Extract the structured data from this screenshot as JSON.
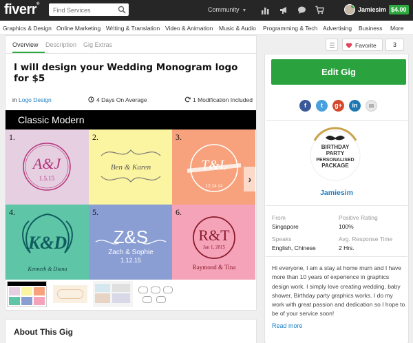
{
  "topbar": {
    "logo": "fiverr",
    "logo_mark": "®",
    "search_placeholder": "Find Services",
    "community": "Community",
    "username": "Jamiesim",
    "balance": "$4.00",
    "icons": [
      "bar-chart-icon",
      "megaphone-icon",
      "chat-icon",
      "cart-icon"
    ]
  },
  "categories": [
    "Graphics & Design",
    "Online Marketing",
    "Writing & Translation",
    "Video & Animation",
    "Music & Audio",
    "Programming & Tech",
    "Advertising",
    "Business",
    "More"
  ],
  "tabs": [
    "Overview",
    "Description",
    "Gig Extras"
  ],
  "gig": {
    "title": "I will design your Wedding Monogram logo for $5",
    "category_prefix": "in",
    "category": "Logo Design",
    "delivery": "4 Days On Average",
    "modifications": "1 Modification Included",
    "banner": "Classic Modern",
    "samples": [
      {
        "num": "1.",
        "initials": "A&J",
        "line": "1.5.15",
        "bg": "#e5cfe1"
      },
      {
        "num": "2.",
        "initials": "Ben & Karen",
        "line": "",
        "bg": "#fbf4a0"
      },
      {
        "num": "3.",
        "initials": "T&L",
        "line": "12.24.14",
        "bg": "#f7a27c"
      },
      {
        "num": "4.",
        "initials": "K&D",
        "line": "Kenneth & Diana",
        "bg": "#5ec6a6"
      },
      {
        "num": "5.",
        "initials": "Z&S",
        "line": "Zach & Sophie",
        "line2": "1.12.15",
        "bg": "#8a9ed3"
      },
      {
        "num": "6.",
        "initials": "R&T",
        "line": "Jan 1, 2015",
        "line2": "Raymond & Tina",
        "bg": "#f5a3b8"
      }
    ]
  },
  "about": {
    "heading": "About This Gig"
  },
  "actions": {
    "favorite_label": "Favorite",
    "favorite_count": "3",
    "edit_label": "Edit Gig"
  },
  "social": [
    {
      "name": "facebook",
      "glyph": "f",
      "color": "#3b5998"
    },
    {
      "name": "twitter",
      "glyph": "t",
      "color": "#4aa0dc"
    },
    {
      "name": "google-plus",
      "glyph": "g+",
      "color": "#d6492f"
    },
    {
      "name": "linkedin",
      "glyph": "in",
      "color": "#1e78b4"
    },
    {
      "name": "email",
      "glyph": "✉",
      "color": "#e8e8e8"
    }
  ],
  "seller": {
    "logo_lines": [
      "BIRTHDAY",
      "PARTY",
      "PERSONALISED",
      "PACKAGE"
    ],
    "name": "Jamiesim",
    "from_label": "From",
    "from": "Singapore",
    "rating_label": "Positive Rating",
    "rating": "100%",
    "speaks_label": "Speaks",
    "speaks": "English, Chinese",
    "response_label": "Avg. Response Time",
    "response": "2 Hrs.",
    "bio": "Hi everyone, I am a stay at home mum and I have more than 10 years of experience in graphics design work. I simply love creating wedding, baby shower, Birthday party graphics works. I do my work with great passion and dedication so I hope to be of your service soon!",
    "read_more": "Read more"
  }
}
